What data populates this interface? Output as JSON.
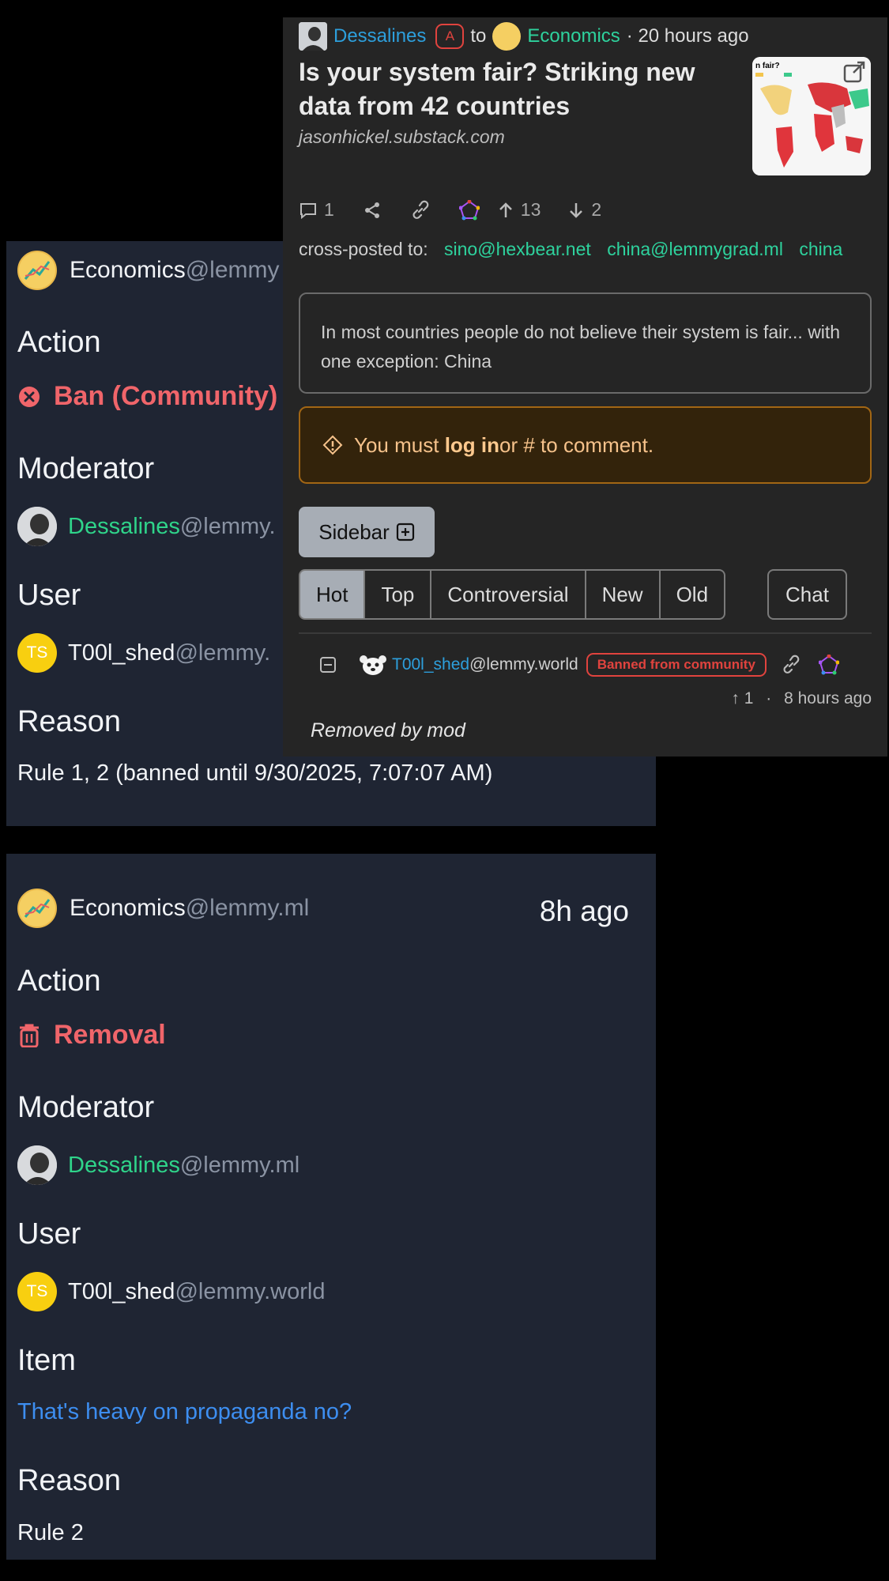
{
  "modlog": [
    {
      "community": {
        "name": "Economics",
        "instance": "@lemmy"
      },
      "action_label": "Action",
      "action": "Ban (Community)",
      "moderator_label": "Moderator",
      "moderator": {
        "name": "Dessalines",
        "instance": "@lemmy."
      },
      "user_label": "User",
      "user": {
        "initials": "TS",
        "name": "T00l_shed",
        "instance": "@lemmy."
      },
      "reason_label": "Reason",
      "reason": "Rule 1, 2 (banned until 9/30/2025, 7:07:07 AM)"
    },
    {
      "community": {
        "name": "Economics",
        "instance": "@lemmy.ml"
      },
      "time": "8h ago",
      "action_label": "Action",
      "action": "Removal",
      "moderator_label": "Moderator",
      "moderator": {
        "name": "Dessalines",
        "instance": "@lemmy.ml"
      },
      "user_label": "User",
      "user": {
        "initials": "TS",
        "name": "T00l_shed",
        "instance": "@lemmy.world"
      },
      "item_label": "Item",
      "item": "That's heavy on propaganda no?",
      "reason_label": "Reason",
      "reason": "Rule 2"
    }
  ],
  "post": {
    "creator": "Dessalines",
    "admin_badge": "A",
    "to": "to",
    "community": "Economics",
    "time": "· 20 hours ago",
    "title": "Is your system fair? Striking new data from 42 countries",
    "domain": "jasonhickel.substack.com",
    "thumb_text": "n fair?",
    "comments": "1",
    "upvotes": "13",
    "downvotes": "2",
    "cross_label": "cross-posted to:",
    "cross_links": [
      "sino@hexbear.net",
      "china@lemmygrad.ml",
      "china"
    ],
    "body": "In most countries people do not believe their system is fair... with one exception: China",
    "warn_pre": "You must ",
    "warn_login": "log in",
    "warn_post": " or # to comment.",
    "sidebar": "Sidebar",
    "tabs": [
      "Hot",
      "Top",
      "Controversial",
      "New",
      "Old"
    ],
    "chat": "Chat"
  },
  "comment": {
    "user": "T00l_shed",
    "instance": "@lemmy.world",
    "badge": "Banned from community",
    "score": "1",
    "time": "8 hours ago",
    "removed": "Removed by mod"
  },
  "colors": {
    "mod": "#2fd48a",
    "danger": "#f0656a",
    "link": "#3d8ef0",
    "panel": "#1f2533"
  }
}
